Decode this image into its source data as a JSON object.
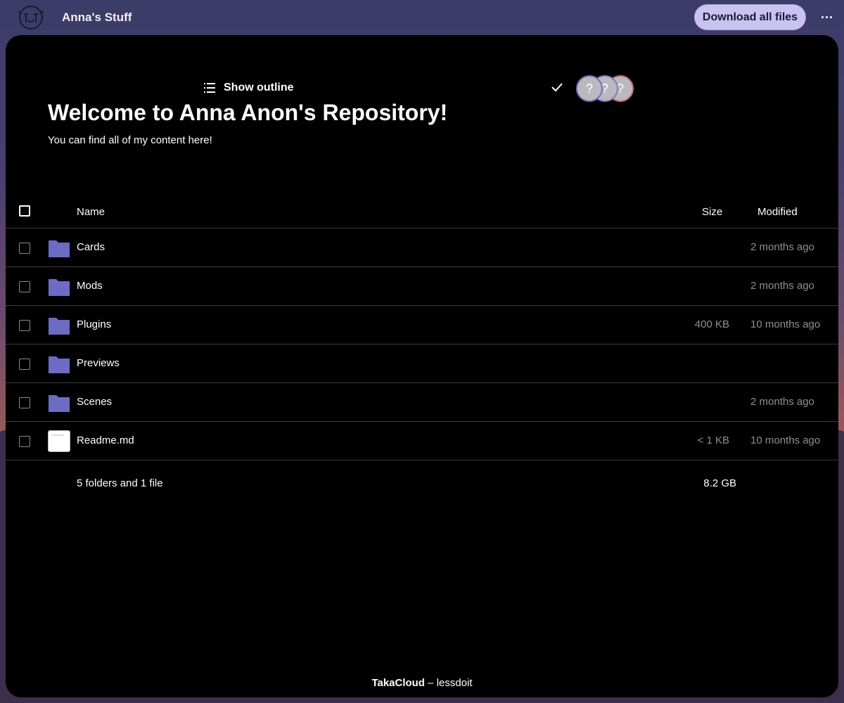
{
  "header": {
    "app_title": "Anna's Stuff",
    "download_label": "Download all files",
    "logo_icon": "folder-stack-logo-icon",
    "more_icon": "more-horizontal-icon"
  },
  "toolbar": {
    "outline_label": "Show outline",
    "outline_icon": "list-icon",
    "check_icon": "checkmark-icon",
    "avatars": [
      "?",
      "?",
      "?"
    ]
  },
  "page": {
    "heading": "Welcome to Anna Anon's Repository!",
    "subtitle": "You can find all of my content here!"
  },
  "table": {
    "columns": {
      "name": "Name",
      "size": "Size",
      "modified": "Modified"
    },
    "rows": [
      {
        "type": "folder",
        "name": "Cards",
        "size": "",
        "modified": "2 months ago"
      },
      {
        "type": "folder",
        "name": "Mods",
        "size": "",
        "modified": "2 months ago"
      },
      {
        "type": "folder",
        "name": "Plugins",
        "size": "400 KB",
        "modified": "10 months ago"
      },
      {
        "type": "folder",
        "name": "Previews",
        "size": "",
        "modified": ""
      },
      {
        "type": "folder",
        "name": "Scenes",
        "size": "",
        "modified": "2 months ago"
      },
      {
        "type": "file",
        "name": "Readme.md",
        "size": "< 1 KB",
        "modified": "10 months ago"
      }
    ],
    "summary": {
      "text": "5 folders and 1 file",
      "size": "8.2 GB"
    }
  },
  "footer": {
    "brand": "TakaCloud",
    "separator": " – ",
    "tagline": "lessdoit"
  },
  "colors": {
    "accent": "#c9c3f1",
    "folder": "#6c6cc4",
    "panel": "#000000",
    "muted_text": "#8f8f8f"
  }
}
